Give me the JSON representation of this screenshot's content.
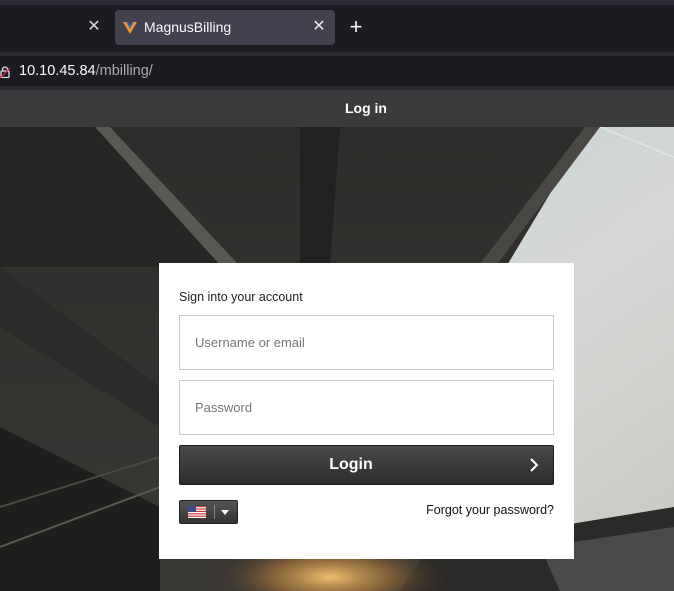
{
  "browser": {
    "active_tab": {
      "title": "MagnusBilling"
    },
    "address": {
      "host": "10.10.45.84",
      "path": "/mbilling/"
    }
  },
  "page": {
    "header_title": "Log in"
  },
  "login_form": {
    "heading": "Sign into your account",
    "username": {
      "placeholder": "Username or email",
      "value": ""
    },
    "password": {
      "placeholder": "Password",
      "value": ""
    },
    "submit_label": "Login",
    "language": {
      "selected": "en-US",
      "icon": "us-flag-icon"
    },
    "forgot_password_label": "Forgot your password?"
  },
  "colors": {
    "header_bg": "#3a3b3d",
    "button_bg": "#333333",
    "card_bg": "#ffffff"
  }
}
